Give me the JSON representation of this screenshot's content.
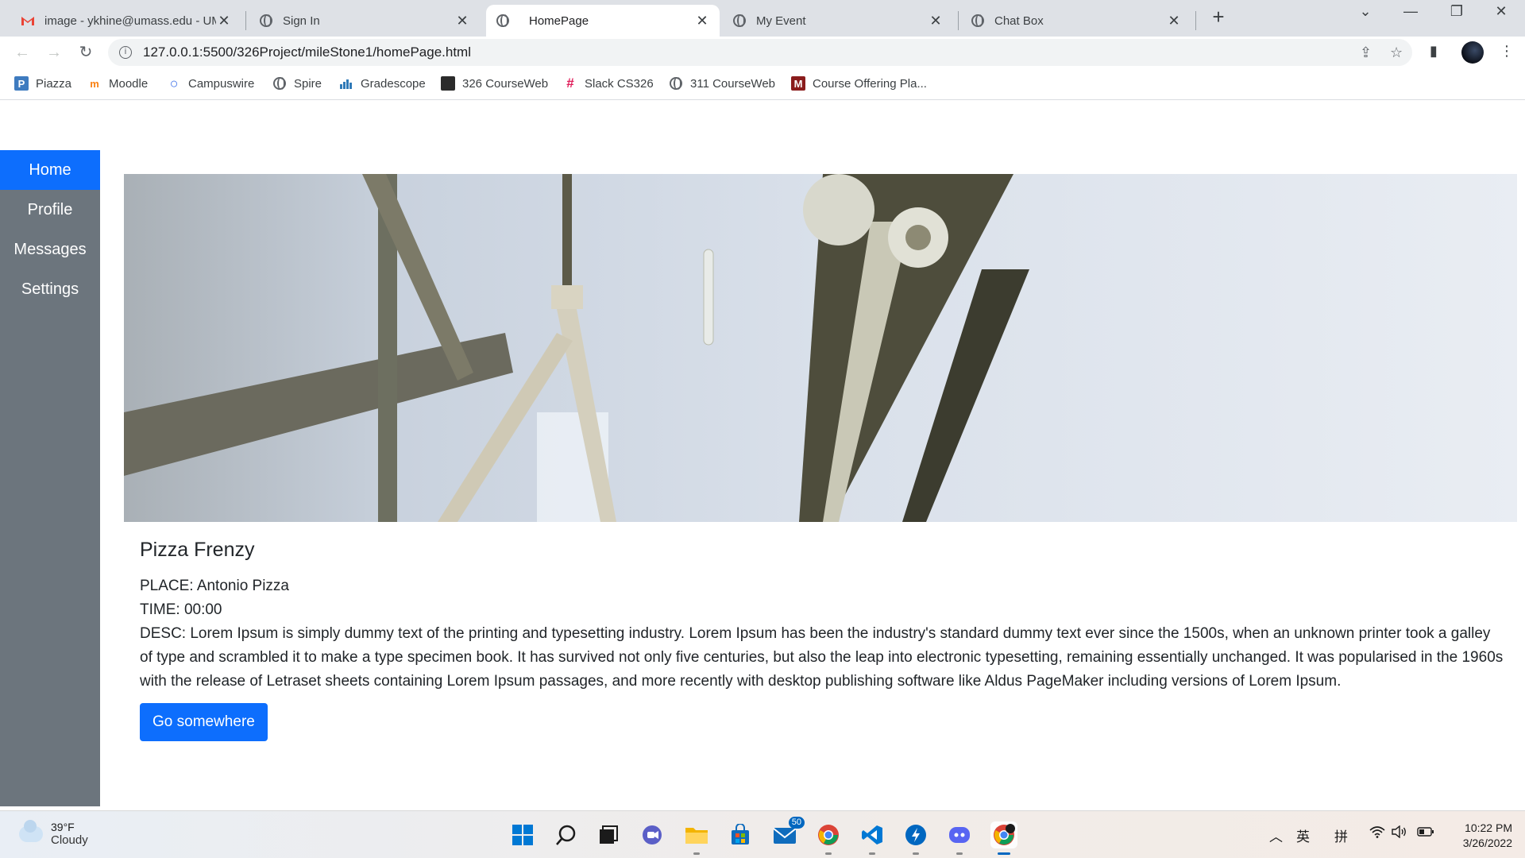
{
  "browser": {
    "tabs": [
      {
        "title": "image - ykhine@umass.edu - UMass Amherst Mail",
        "icon": "gmail-icon",
        "active": false
      },
      {
        "title": "Sign In",
        "icon": "globe-icon",
        "active": false
      },
      {
        "title": "HomePage",
        "icon": "globe-icon",
        "active": true
      },
      {
        "title": "My Event",
        "icon": "globe-icon",
        "active": false
      },
      {
        "title": "Chat Box",
        "icon": "globe-icon",
        "active": false
      }
    ],
    "url": "127.0.0.1:5500/326Project/mileStone1/homePage.html",
    "bookmarks": [
      {
        "label": "Piazza",
        "color": "#3e7bbf",
        "glyph": "P"
      },
      {
        "label": "Moodle",
        "color": "#f98012",
        "glyph": "m"
      },
      {
        "label": "Campuswire",
        "color": "#3b6ee8",
        "glyph": "○"
      },
      {
        "label": "Spire",
        "color": "#5f6368",
        "glyph": "●"
      },
      {
        "label": "Gradescope",
        "color": "#2f7ab8",
        "glyph": "▮"
      },
      {
        "label": "326 CourseWeb",
        "color": "#2b2b2b",
        "glyph": "▣"
      },
      {
        "label": "Slack CS326",
        "color": "#e01e5a",
        "glyph": "#"
      },
      {
        "label": "311 CourseWeb",
        "color": "#5f6368",
        "glyph": "●"
      },
      {
        "label": "Course Offering Pla...",
        "color": "#8a1c1c",
        "glyph": "M"
      }
    ]
  },
  "sidebar": {
    "items": [
      {
        "label": "Home",
        "active": true
      },
      {
        "label": "Profile",
        "active": false
      },
      {
        "label": "Messages",
        "active": false
      },
      {
        "label": "Settings",
        "active": false
      }
    ]
  },
  "card": {
    "title": "Pizza Frenzy",
    "place": "PLACE: Antonio Pizza",
    "time": "TIME: 00:00",
    "desc": "DESC: Lorem Ipsum is simply dummy text of the printing and typesetting industry. Lorem Ipsum has been the industry's standard dummy text ever since the 1500s, when an unknown printer took a galley of type and scrambled it to make a type specimen book. It has survived not only five centuries, but also the leap into electronic typesetting, remaining essentially unchanged. It was popularised in the 1960s with the release of Letraset sheets containing Lorem Ipsum passages, and more recently with desktop publishing software like Aldus PageMaker including versions of Lorem Ipsum.",
    "button": "Go somewhere"
  },
  "taskbar": {
    "weather_temp": "39°F",
    "weather_cond": "Cloudy",
    "mail_badge": "50",
    "ime1": "英",
    "ime2": "拼",
    "time": "10:22 PM",
    "date": "3/26/2022"
  }
}
